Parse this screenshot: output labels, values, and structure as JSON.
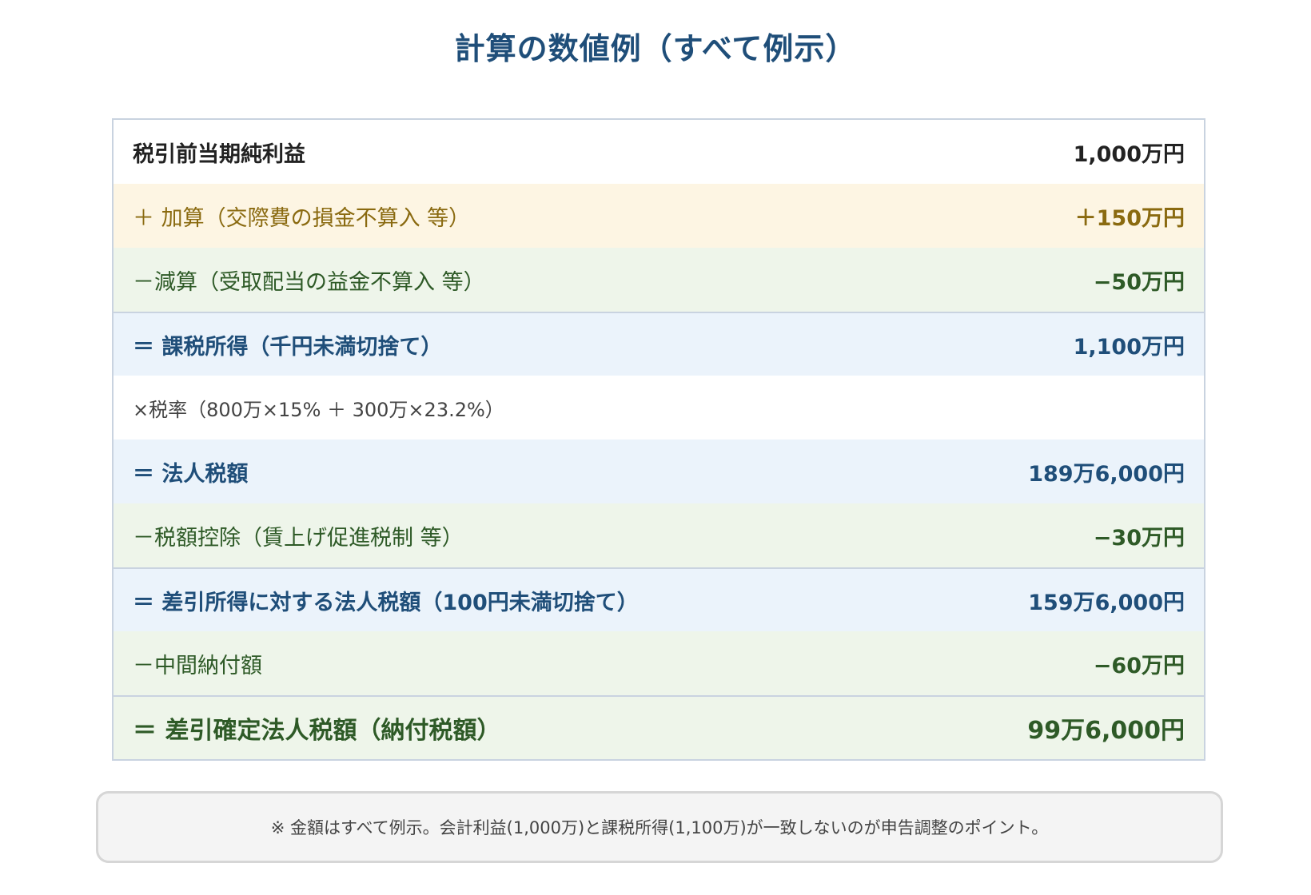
{
  "title": "計算の数値例（すべて例示）",
  "rows": [
    {
      "label": "税引前当期純利益",
      "value": "1,000万円"
    },
    {
      "label": "＋ 加算（交際費の損金不算入 等）",
      "value": "＋150万円"
    },
    {
      "label": "－減算（受取配当の益金不算入 等）",
      "value": "−50万円"
    },
    {
      "label": "＝ 課税所得（千円未満切捨て）",
      "value": "1,100万円"
    },
    {
      "label": "×税率（800万×15% ＋ 300万×23.2%）",
      "value": ""
    },
    {
      "label": "＝ 法人税額",
      "value": "189万6,000円"
    },
    {
      "label": "－税額控除（賃上げ促進税制 等）",
      "value": "−30万円"
    },
    {
      "label": "＝ 差引所得に対する法人税額（100円未満切捨て）",
      "value": "159万6,000円"
    },
    {
      "label": "－中間納付額",
      "value": "−60万円"
    },
    {
      "label": "＝ 差引確定法人税額（納付税額）",
      "value": "99万6,000円"
    }
  ],
  "note": "※ 金額はすべて例示。会計利益(1,000万)と課税所得(1,100万)が一致しないのが申告調整のポイント。",
  "colors": {
    "title": "#1f4e79",
    "add": "#8a6a10",
    "subtract": "#2e5a27",
    "equals": "#1f4e79"
  }
}
